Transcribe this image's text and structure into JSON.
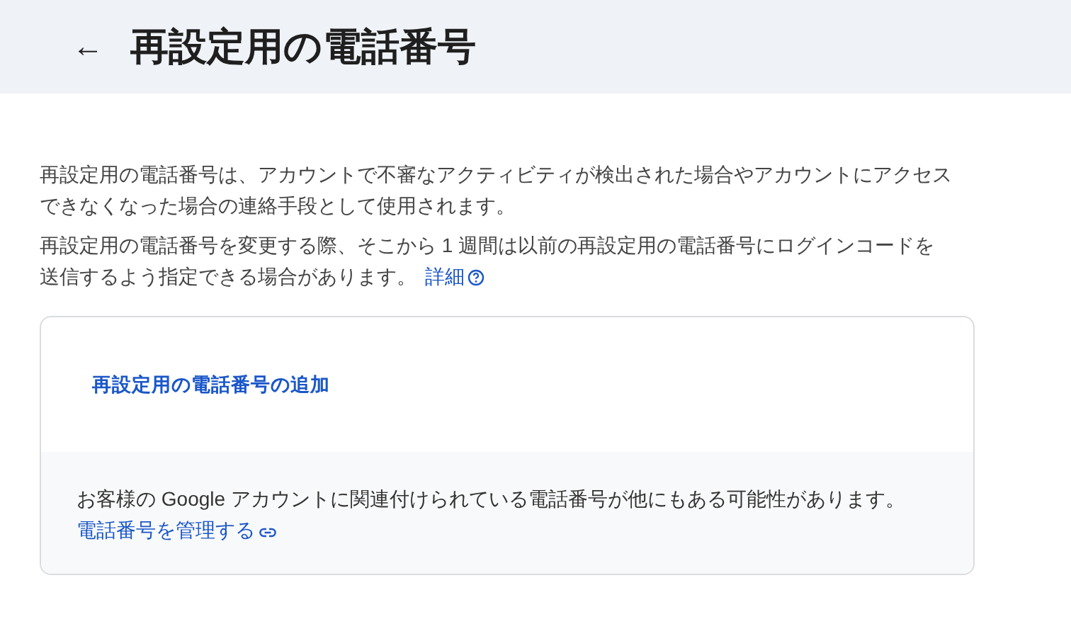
{
  "header": {
    "back_icon": "←",
    "title": "再設定用の電話番号"
  },
  "intro": {
    "paragraphs": [
      {
        "text": "再設定用の電話番号は、アカウントで不審なアクティビティが検出された場合やアカウントにアクセスできなくなった場合の連絡手段として使用されます。"
      },
      {
        "text": "再設定用の電話番号を変更する際、そこから 1 週間は以前の再設定用の電話番号にログインコードを送信するよう指定できる場合があります。",
        "link": "詳細"
      }
    ]
  },
  "card": {
    "add_button": "再設定用の電話番号の追加",
    "note": "お客様の Google アカウントに関連付けられている電話番号が他にもある可能性があります。",
    "note_link": "電話番号を管理する"
  }
}
